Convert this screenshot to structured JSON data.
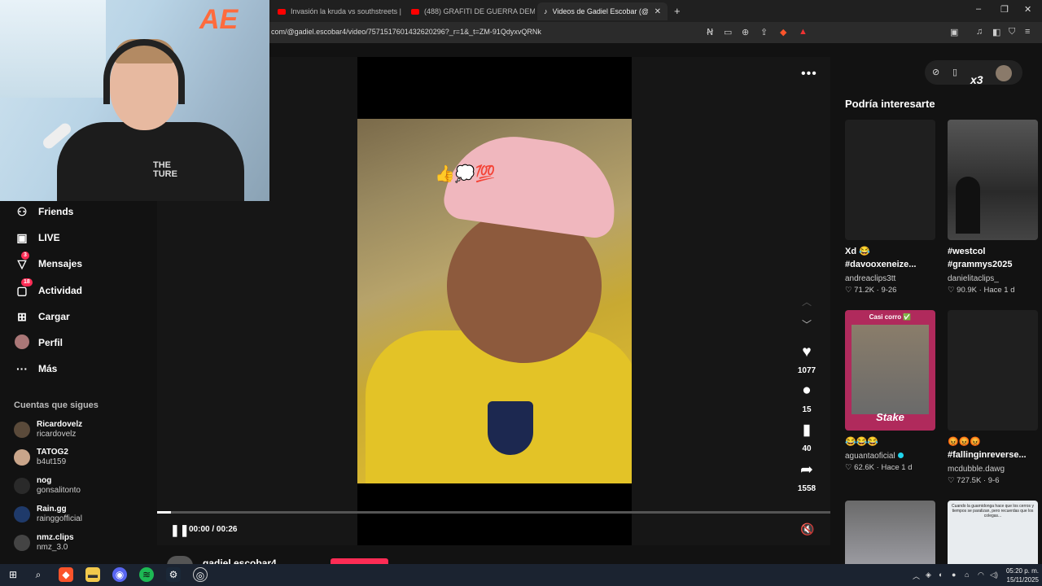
{
  "browser": {
    "tabs": [
      {
        "title": "Invasión la kruda vs southstreets | DO"
      },
      {
        "title": "(488) GRAFITI DE GUERRA DEMONS"
      },
      {
        "title": "Videos de Gadiel Escobar (@gadi"
      }
    ],
    "new_tab": "+",
    "close_tab": "✕",
    "url": "com/@gadiel.escobar4/video/7571517601432620296?_r=1&_t=ZM-91QdyxvQRNk",
    "win_min": "–",
    "win_max": "❐",
    "win_close": "✕"
  },
  "sidebar": {
    "items": [
      {
        "label": "Friends",
        "icon": "friends-icon"
      },
      {
        "label": "LIVE",
        "icon": "live-icon"
      },
      {
        "label": "Mensajes",
        "icon": "messages-icon",
        "badge": "3"
      },
      {
        "label": "Actividad",
        "icon": "activity-icon",
        "badge": "18"
      },
      {
        "label": "Cargar",
        "icon": "upload-icon"
      },
      {
        "label": "Perfil",
        "icon": "profile-icon"
      },
      {
        "label": "Más",
        "icon": "more-icon"
      }
    ],
    "following_title": "Cuentas que sigues",
    "following": [
      {
        "name": "Ricardovelz",
        "handle": "ricardovelz",
        "color": "#5a4a3a"
      },
      {
        "name": "TATOG2",
        "handle": "b4ut159",
        "color": "#c9a58a"
      },
      {
        "name": "nog",
        "handle": "gonsalitonto",
        "color": "#2a2a2a"
      },
      {
        "name": "Rain.gg",
        "handle": "rainggofficial",
        "color": "#1f3a6a"
      },
      {
        "name": "nmz.clips",
        "handle": "nmz_3.0",
        "color": "#444444"
      }
    ]
  },
  "video": {
    "emoji_overlay": "👍💭💯",
    "likes": "1077",
    "comments": "15",
    "saves": "40",
    "shares": "1558",
    "progress": 0.02,
    "time": "00:00 / 00:26",
    "author": "gadiel.escobar4"
  },
  "recommended": {
    "title": "Podría interesarte",
    "items": [
      {
        "caption1": "Xd 😂",
        "caption2": "#davooxeneize...",
        "user": "andreaclips3tt",
        "likes": "71.2K",
        "date": "9-26",
        "thumb": "#1f1f1f",
        "verified": false
      },
      {
        "caption1": "#westcol",
        "caption2": "#grammys2025",
        "user": "danielitaclips_",
        "likes": "90.9K",
        "date": "Hace 1 d",
        "thumb": "#3a3a3a",
        "verified": false
      },
      {
        "caption1": "😂😂😂",
        "caption2": "",
        "user": "aguantaoficial",
        "likes": "62.6K",
        "date": "Hace 1 d",
        "thumb": "#b02a5c",
        "verified": true
      },
      {
        "caption1": "😡😡😡",
        "caption2": "#fallinginreverse...",
        "user": "mcdubble.dawg",
        "likes": "727.5K",
        "date": "9-6",
        "thumb": "#1f1f1f",
        "verified": false
      }
    ],
    "thumb_overlay_2": "Casi corro ✅",
    "thumb_overlay_3": "Stake",
    "thumb_text_6": "Cuando la guarnidonga hace que los cerros y tiempos se paralizan, pero recuerdas que los colegas..."
  },
  "webcam": {
    "logo": "AE",
    "shirt_text": "THE TURE"
  },
  "taskbar": {
    "time": "05:20 p. m.",
    "date": "15/11/2025"
  },
  "colors": {
    "accent": "#fe2c55",
    "bg": "#121212"
  }
}
